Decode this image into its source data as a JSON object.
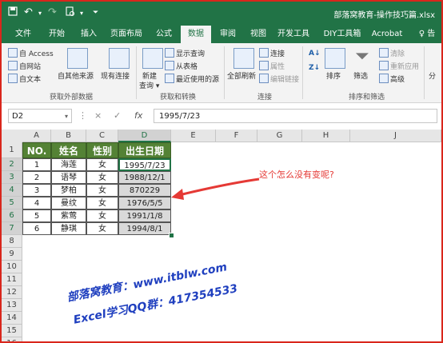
{
  "window": {
    "title": "部落窝教育-操作技巧篇.xlsx",
    "quick_access": [
      "save-icon",
      "undo-icon",
      "redo-icon",
      "print-preview-icon",
      "customize-icon"
    ]
  },
  "tabs": [
    {
      "label": "文件",
      "active": false
    },
    {
      "label": "开始",
      "active": false
    },
    {
      "label": "插入",
      "active": false
    },
    {
      "label": "页面布局",
      "active": false
    },
    {
      "label": "公式",
      "active": false
    },
    {
      "label": "数据",
      "active": true
    },
    {
      "label": "审阅",
      "active": false
    },
    {
      "label": "视图",
      "active": false
    },
    {
      "label": "开发工具",
      "active": false
    },
    {
      "label": "DIY工具箱",
      "active": false
    },
    {
      "label": "Acrobat",
      "active": false
    },
    {
      "label": "♀ 告",
      "active": false
    }
  ],
  "ribbon": {
    "get_external": {
      "access": "自 Access",
      "web": "自网站",
      "text": "自文本",
      "other": "自其他来源",
      "existing": "现有连接",
      "group_label": "获取外部数据"
    },
    "transform": {
      "new_query": "新建",
      "new_query2": "查询",
      "show_queries": "显示查询",
      "from_table": "从表格",
      "recent_sources": "最近使用的源",
      "group_label": "获取和转换"
    },
    "connections": {
      "refresh_all": "全部刷新",
      "connections": "连接",
      "properties": "属性",
      "edit_links": "编辑链接",
      "group_label": "连接"
    },
    "sort_filter": {
      "sort": "排序",
      "filter": "筛选",
      "clear": "清除",
      "reapply": "重新应用",
      "advanced": "高级",
      "group_label": "排序和筛选"
    },
    "overflow": "分"
  },
  "formula_bar": {
    "name_box": "D2",
    "cancel": "×",
    "enter": "✓",
    "fx": "fx",
    "value": "1995/7/23"
  },
  "sheet": {
    "columns": [
      "A",
      "B",
      "C",
      "D",
      "E",
      "F",
      "G",
      "H",
      "J"
    ],
    "selected_column": "D",
    "rows": [
      "1",
      "2",
      "3",
      "4",
      "5",
      "6",
      "7",
      "8",
      "9",
      "10",
      "11",
      "12",
      "13",
      "14",
      "15",
      "16"
    ],
    "selected_rows": [
      "2",
      "3",
      "4",
      "5",
      "6",
      "7"
    ],
    "table_headers": [
      "NO.",
      "姓名",
      "性别",
      "出生日期"
    ],
    "table_rows": [
      [
        "1",
        "海莲",
        "女",
        "1995/7/23"
      ],
      [
        "2",
        "语琴",
        "女",
        "1988/12/1"
      ],
      [
        "3",
        "梦柏",
        "女",
        "870229"
      ],
      [
        "4",
        "曼纹",
        "女",
        "1976/5/5"
      ],
      [
        "5",
        "紫莺",
        "女",
        "1991/1/8"
      ],
      [
        "6",
        "静琪",
        "女",
        "1994/8/1"
      ]
    ]
  },
  "annotation": "这个怎么没有变呢?",
  "watermark": {
    "line1": "部落窝教育：www.itblw.com",
    "line2": "Excel学习QQ群：417354533"
  },
  "colors": {
    "excel_green": "#217346",
    "header_fill": "#548235",
    "annotation_red": "#e53935",
    "watermark_blue": "#1f3fbf",
    "frame_red": "#d9261c"
  }
}
